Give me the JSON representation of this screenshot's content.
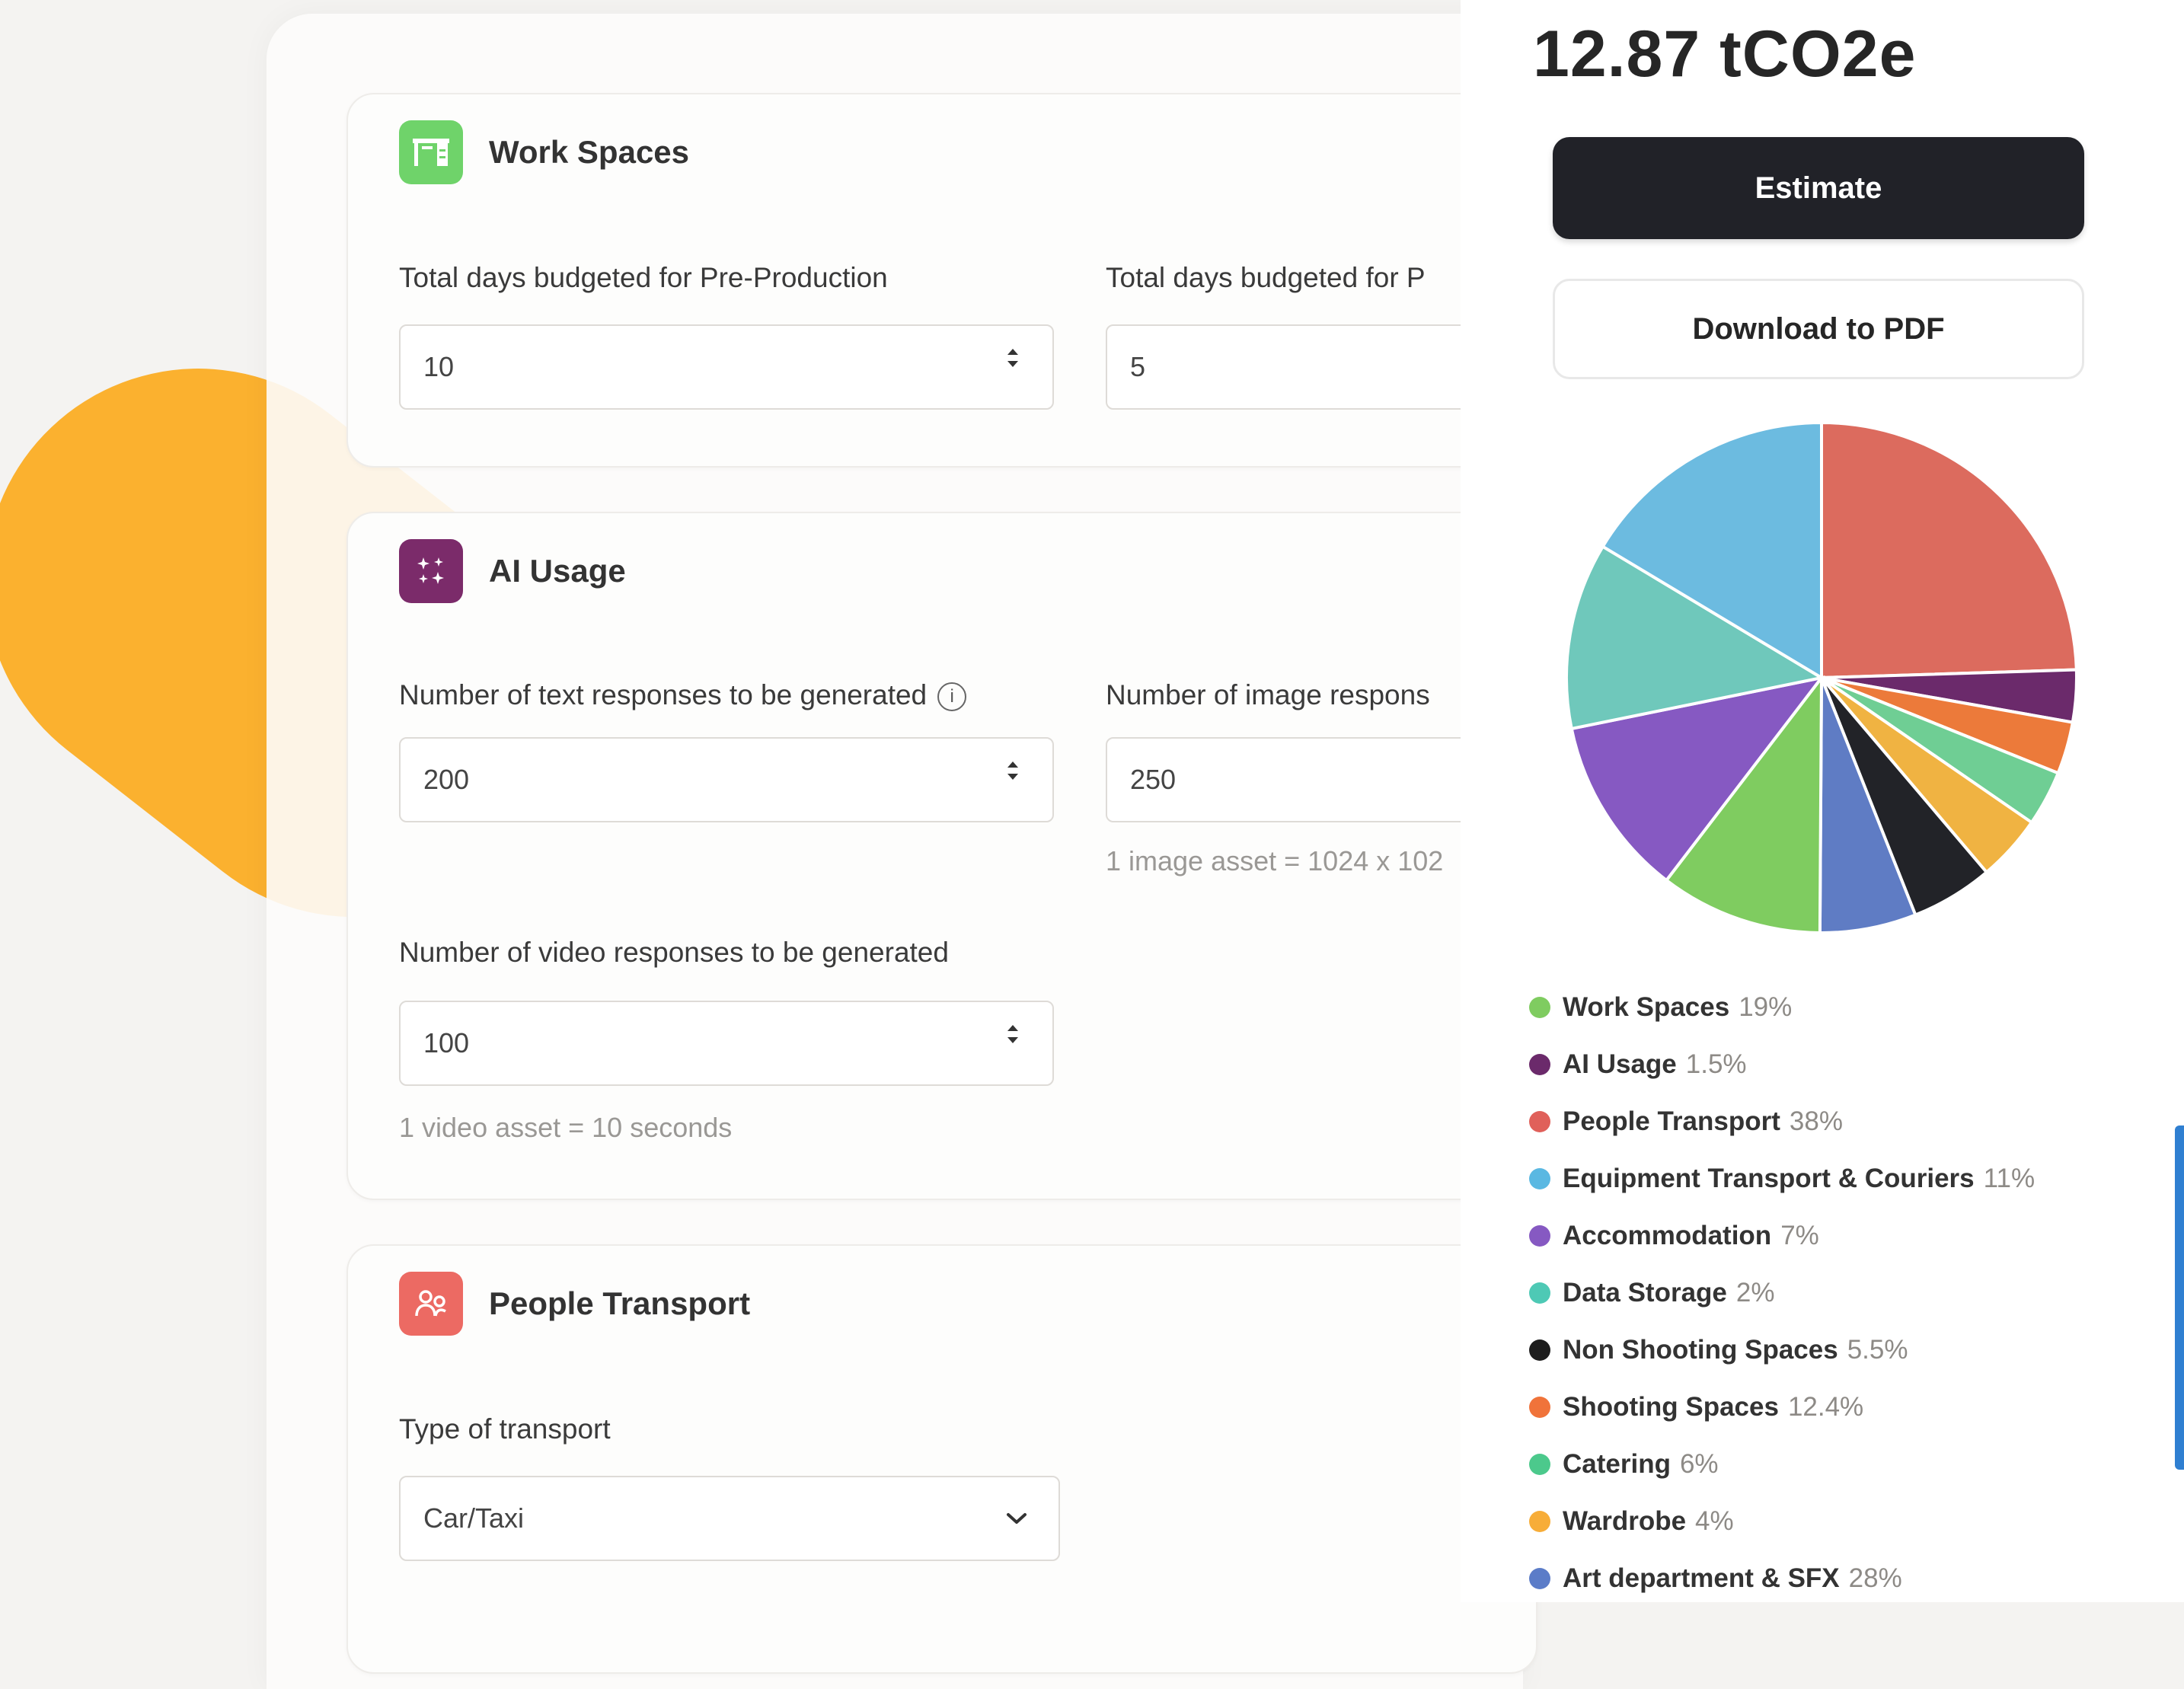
{
  "work_spaces": {
    "title": "Work Spaces",
    "pre_production_label": "Total days budgeted for Pre-Production",
    "pre_production_value": "10",
    "production_label": "Total days budgeted for P",
    "production_value": "5"
  },
  "ai_usage": {
    "title": "AI Usage",
    "text_label": "Number of text responses to be generated",
    "text_value": "200",
    "image_label": "Number of image respons",
    "image_value": "250",
    "image_hint": "1 image asset = 1024 x 102",
    "video_label": "Number of video responses to be generated",
    "video_value": "100",
    "video_hint": "1 video asset = 10 seconds"
  },
  "people_transport": {
    "title": "People Transport",
    "type_label": "Type of transport",
    "type_value": "Car/Taxi"
  },
  "summary": {
    "total": "12.87 tCO2e",
    "estimate_label": "Estimate",
    "download_label": "Download to PDF"
  },
  "chart_data": {
    "type": "pie",
    "slices": [
      {
        "name": "Art department & SFX",
        "legend_value": "28%",
        "fraction": 0.245,
        "color": "#dc6b5e"
      },
      {
        "name": "AI Usage",
        "legend_value": "1.5%",
        "fraction": 0.033,
        "color": "#6b2a6b"
      },
      {
        "name": "Shooting Spaces",
        "legend_value": "12.4%",
        "fraction": 0.033,
        "color": "#ec7a3a"
      },
      {
        "name": "Catering",
        "legend_value": "6%",
        "fraction": 0.035,
        "color": "#6fce94"
      },
      {
        "name": "Wardrobe",
        "legend_value": "4%",
        "fraction": 0.042,
        "color": "#f0b342"
      },
      {
        "name": "Non Shooting Spaces",
        "legend_value": "5.5%",
        "fraction": 0.052,
        "color": "#222328"
      },
      {
        "name": "Art department & SFX",
        "legend_value": "28%",
        "fraction": 0.061,
        "color": "#5f7cc4"
      },
      {
        "name": "Work Spaces",
        "legend_value": "19%",
        "fraction": 0.103,
        "color": "#7fcc60"
      },
      {
        "name": "Accommodation",
        "legend_value": "7%",
        "fraction": 0.114,
        "color": "#8659c2"
      },
      {
        "name": "Data Storage",
        "legend_value": "2%",
        "fraction": 0.118,
        "color": "#6fc8bb"
      },
      {
        "name": "Equipment Transport & Couriers",
        "legend_value": "11%",
        "fraction": 0.164,
        "color": "#6cbbe0"
      }
    ],
    "legend": [
      {
        "name": "Work Spaces",
        "value": "19%",
        "color": "#7fcc60"
      },
      {
        "name": "AI Usage",
        "value": "1.5%",
        "color": "#6b2a6b"
      },
      {
        "name": "People Transport",
        "value": "38%",
        "color": "#e0605a"
      },
      {
        "name": "Equipment Transport & Couriers",
        "value": "11%",
        "color": "#5ab8e2"
      },
      {
        "name": "Accommodation",
        "value": "7%",
        "color": "#8659c2"
      },
      {
        "name": "Data Storage",
        "value": "2%",
        "color": "#4ec9b5"
      },
      {
        "name": "Non Shooting Spaces",
        "value": "5.5%",
        "color": "#1e1e1e"
      },
      {
        "name": "Shooting Spaces",
        "value": "12.4%",
        "color": "#f0733a"
      },
      {
        "name": "Catering",
        "value": "6%",
        "color": "#4cc98c"
      },
      {
        "name": "Wardrobe",
        "value": "4%",
        "color": "#f7ad38"
      },
      {
        "name": "Art department & SFX",
        "value": "28%",
        "color": "#5b7cc8"
      }
    ]
  }
}
